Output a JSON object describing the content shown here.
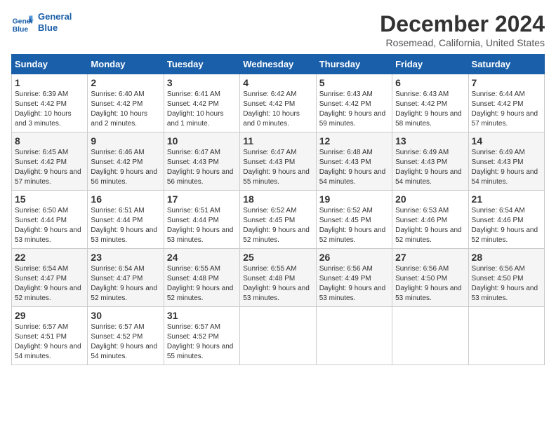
{
  "header": {
    "logo_line1": "General",
    "logo_line2": "Blue",
    "month": "December 2024",
    "location": "Rosemead, California, United States"
  },
  "columns": [
    "Sunday",
    "Monday",
    "Tuesday",
    "Wednesday",
    "Thursday",
    "Friday",
    "Saturday"
  ],
  "weeks": [
    [
      {
        "day": "1",
        "sunrise": "6:39 AM",
        "sunset": "4:42 PM",
        "daylight": "10 hours and 3 minutes."
      },
      {
        "day": "2",
        "sunrise": "6:40 AM",
        "sunset": "4:42 PM",
        "daylight": "10 hours and 2 minutes."
      },
      {
        "day": "3",
        "sunrise": "6:41 AM",
        "sunset": "4:42 PM",
        "daylight": "10 hours and 1 minute."
      },
      {
        "day": "4",
        "sunrise": "6:42 AM",
        "sunset": "4:42 PM",
        "daylight": "10 hours and 0 minutes."
      },
      {
        "day": "5",
        "sunrise": "6:43 AM",
        "sunset": "4:42 PM",
        "daylight": "9 hours and 59 minutes."
      },
      {
        "day": "6",
        "sunrise": "6:43 AM",
        "sunset": "4:42 PM",
        "daylight": "9 hours and 58 minutes."
      },
      {
        "day": "7",
        "sunrise": "6:44 AM",
        "sunset": "4:42 PM",
        "daylight": "9 hours and 57 minutes."
      }
    ],
    [
      {
        "day": "8",
        "sunrise": "6:45 AM",
        "sunset": "4:42 PM",
        "daylight": "9 hours and 57 minutes."
      },
      {
        "day": "9",
        "sunrise": "6:46 AM",
        "sunset": "4:42 PM",
        "daylight": "9 hours and 56 minutes."
      },
      {
        "day": "10",
        "sunrise": "6:47 AM",
        "sunset": "4:43 PM",
        "daylight": "9 hours and 56 minutes."
      },
      {
        "day": "11",
        "sunrise": "6:47 AM",
        "sunset": "4:43 PM",
        "daylight": "9 hours and 55 minutes."
      },
      {
        "day": "12",
        "sunrise": "6:48 AM",
        "sunset": "4:43 PM",
        "daylight": "9 hours and 54 minutes."
      },
      {
        "day": "13",
        "sunrise": "6:49 AM",
        "sunset": "4:43 PM",
        "daylight": "9 hours and 54 minutes."
      },
      {
        "day": "14",
        "sunrise": "6:49 AM",
        "sunset": "4:43 PM",
        "daylight": "9 hours and 54 minutes."
      }
    ],
    [
      {
        "day": "15",
        "sunrise": "6:50 AM",
        "sunset": "4:44 PM",
        "daylight": "9 hours and 53 minutes."
      },
      {
        "day": "16",
        "sunrise": "6:51 AM",
        "sunset": "4:44 PM",
        "daylight": "9 hours and 53 minutes."
      },
      {
        "day": "17",
        "sunrise": "6:51 AM",
        "sunset": "4:44 PM",
        "daylight": "9 hours and 53 minutes."
      },
      {
        "day": "18",
        "sunrise": "6:52 AM",
        "sunset": "4:45 PM",
        "daylight": "9 hours and 52 minutes."
      },
      {
        "day": "19",
        "sunrise": "6:52 AM",
        "sunset": "4:45 PM",
        "daylight": "9 hours and 52 minutes."
      },
      {
        "day": "20",
        "sunrise": "6:53 AM",
        "sunset": "4:46 PM",
        "daylight": "9 hours and 52 minutes."
      },
      {
        "day": "21",
        "sunrise": "6:54 AM",
        "sunset": "4:46 PM",
        "daylight": "9 hours and 52 minutes."
      }
    ],
    [
      {
        "day": "22",
        "sunrise": "6:54 AM",
        "sunset": "4:47 PM",
        "daylight": "9 hours and 52 minutes."
      },
      {
        "day": "23",
        "sunrise": "6:54 AM",
        "sunset": "4:47 PM",
        "daylight": "9 hours and 52 minutes."
      },
      {
        "day": "24",
        "sunrise": "6:55 AM",
        "sunset": "4:48 PM",
        "daylight": "9 hours and 52 minutes."
      },
      {
        "day": "25",
        "sunrise": "6:55 AM",
        "sunset": "4:48 PM",
        "daylight": "9 hours and 53 minutes."
      },
      {
        "day": "26",
        "sunrise": "6:56 AM",
        "sunset": "4:49 PM",
        "daylight": "9 hours and 53 minutes."
      },
      {
        "day": "27",
        "sunrise": "6:56 AM",
        "sunset": "4:50 PM",
        "daylight": "9 hours and 53 minutes."
      },
      {
        "day": "28",
        "sunrise": "6:56 AM",
        "sunset": "4:50 PM",
        "daylight": "9 hours and 53 minutes."
      }
    ],
    [
      {
        "day": "29",
        "sunrise": "6:57 AM",
        "sunset": "4:51 PM",
        "daylight": "9 hours and 54 minutes."
      },
      {
        "day": "30",
        "sunrise": "6:57 AM",
        "sunset": "4:52 PM",
        "daylight": "9 hours and 54 minutes."
      },
      {
        "day": "31",
        "sunrise": "6:57 AM",
        "sunset": "4:52 PM",
        "daylight": "9 hours and 55 minutes."
      },
      null,
      null,
      null,
      null
    ]
  ]
}
